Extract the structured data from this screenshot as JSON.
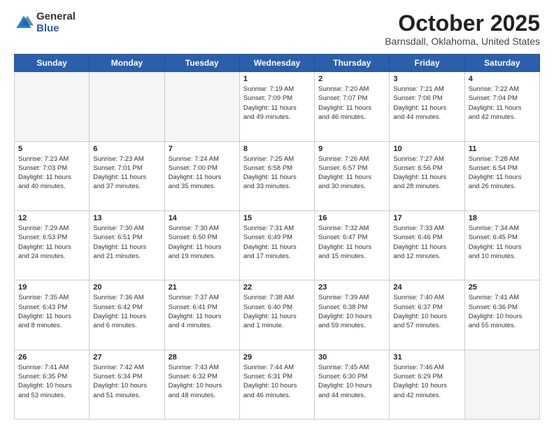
{
  "logo": {
    "general": "General",
    "blue": "Blue"
  },
  "header": {
    "month": "October 2025",
    "location": "Barnsdall, Oklahoma, United States"
  },
  "weekdays": [
    "Sunday",
    "Monday",
    "Tuesday",
    "Wednesday",
    "Thursday",
    "Friday",
    "Saturday"
  ],
  "weeks": [
    [
      {
        "day": "",
        "info": ""
      },
      {
        "day": "",
        "info": ""
      },
      {
        "day": "",
        "info": ""
      },
      {
        "day": "1",
        "info": "Sunrise: 7:19 AM\nSunset: 7:09 PM\nDaylight: 11 hours\nand 49 minutes."
      },
      {
        "day": "2",
        "info": "Sunrise: 7:20 AM\nSunset: 7:07 PM\nDaylight: 11 hours\nand 46 minutes."
      },
      {
        "day": "3",
        "info": "Sunrise: 7:21 AM\nSunset: 7:06 PM\nDaylight: 11 hours\nand 44 minutes."
      },
      {
        "day": "4",
        "info": "Sunrise: 7:22 AM\nSunset: 7:04 PM\nDaylight: 11 hours\nand 42 minutes."
      }
    ],
    [
      {
        "day": "5",
        "info": "Sunrise: 7:23 AM\nSunset: 7:03 PM\nDaylight: 11 hours\nand 40 minutes."
      },
      {
        "day": "6",
        "info": "Sunrise: 7:23 AM\nSunset: 7:01 PM\nDaylight: 11 hours\nand 37 minutes."
      },
      {
        "day": "7",
        "info": "Sunrise: 7:24 AM\nSunset: 7:00 PM\nDaylight: 11 hours\nand 35 minutes."
      },
      {
        "day": "8",
        "info": "Sunrise: 7:25 AM\nSunset: 6:58 PM\nDaylight: 11 hours\nand 33 minutes."
      },
      {
        "day": "9",
        "info": "Sunrise: 7:26 AM\nSunset: 6:57 PM\nDaylight: 11 hours\nand 30 minutes."
      },
      {
        "day": "10",
        "info": "Sunrise: 7:27 AM\nSunset: 6:56 PM\nDaylight: 11 hours\nand 28 minutes."
      },
      {
        "day": "11",
        "info": "Sunrise: 7:28 AM\nSunset: 6:54 PM\nDaylight: 11 hours\nand 26 minutes."
      }
    ],
    [
      {
        "day": "12",
        "info": "Sunrise: 7:29 AM\nSunset: 6:53 PM\nDaylight: 11 hours\nand 24 minutes."
      },
      {
        "day": "13",
        "info": "Sunrise: 7:30 AM\nSunset: 6:51 PM\nDaylight: 11 hours\nand 21 minutes."
      },
      {
        "day": "14",
        "info": "Sunrise: 7:30 AM\nSunset: 6:50 PM\nDaylight: 11 hours\nand 19 minutes."
      },
      {
        "day": "15",
        "info": "Sunrise: 7:31 AM\nSunset: 6:49 PM\nDaylight: 11 hours\nand 17 minutes."
      },
      {
        "day": "16",
        "info": "Sunrise: 7:32 AM\nSunset: 6:47 PM\nDaylight: 11 hours\nand 15 minutes."
      },
      {
        "day": "17",
        "info": "Sunrise: 7:33 AM\nSunset: 6:46 PM\nDaylight: 11 hours\nand 12 minutes."
      },
      {
        "day": "18",
        "info": "Sunrise: 7:34 AM\nSunset: 6:45 PM\nDaylight: 11 hours\nand 10 minutes."
      }
    ],
    [
      {
        "day": "19",
        "info": "Sunrise: 7:35 AM\nSunset: 6:43 PM\nDaylight: 11 hours\nand 8 minutes."
      },
      {
        "day": "20",
        "info": "Sunrise: 7:36 AM\nSunset: 6:42 PM\nDaylight: 11 hours\nand 6 minutes."
      },
      {
        "day": "21",
        "info": "Sunrise: 7:37 AM\nSunset: 6:41 PM\nDaylight: 11 hours\nand 4 minutes."
      },
      {
        "day": "22",
        "info": "Sunrise: 7:38 AM\nSunset: 6:40 PM\nDaylight: 11 hours\nand 1 minute."
      },
      {
        "day": "23",
        "info": "Sunrise: 7:39 AM\nSunset: 6:38 PM\nDaylight: 10 hours\nand 59 minutes."
      },
      {
        "day": "24",
        "info": "Sunrise: 7:40 AM\nSunset: 6:37 PM\nDaylight: 10 hours\nand 57 minutes."
      },
      {
        "day": "25",
        "info": "Sunrise: 7:41 AM\nSunset: 6:36 PM\nDaylight: 10 hours\nand 55 minutes."
      }
    ],
    [
      {
        "day": "26",
        "info": "Sunrise: 7:41 AM\nSunset: 6:35 PM\nDaylight: 10 hours\nand 53 minutes."
      },
      {
        "day": "27",
        "info": "Sunrise: 7:42 AM\nSunset: 6:34 PM\nDaylight: 10 hours\nand 51 minutes."
      },
      {
        "day": "28",
        "info": "Sunrise: 7:43 AM\nSunset: 6:32 PM\nDaylight: 10 hours\nand 48 minutes."
      },
      {
        "day": "29",
        "info": "Sunrise: 7:44 AM\nSunset: 6:31 PM\nDaylight: 10 hours\nand 46 minutes."
      },
      {
        "day": "30",
        "info": "Sunrise: 7:45 AM\nSunset: 6:30 PM\nDaylight: 10 hours\nand 44 minutes."
      },
      {
        "day": "31",
        "info": "Sunrise: 7:46 AM\nSunset: 6:29 PM\nDaylight: 10 hours\nand 42 minutes."
      },
      {
        "day": "",
        "info": ""
      }
    ]
  ]
}
